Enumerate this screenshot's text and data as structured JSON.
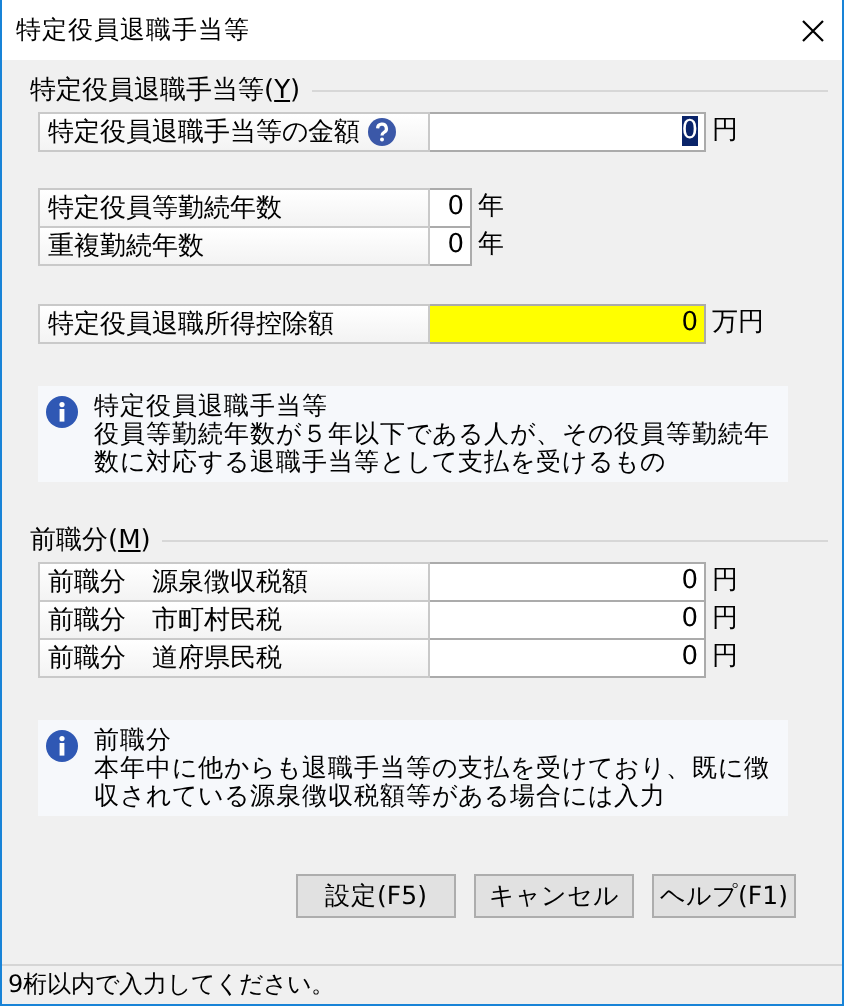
{
  "window": {
    "title": "特定役員退職手当等"
  },
  "retirement": {
    "heading": "特定役員退職手当等(Y)",
    "amount": [
      {
        "label": "特定役員退職手当等の金額",
        "help": true,
        "value": "0",
        "unit": "円",
        "focused": true,
        "highlighted": false
      }
    ],
    "years": [
      {
        "label": "特定役員等勤続年数",
        "help": false,
        "value": "0",
        "unit": "年",
        "focused": false,
        "highlighted": false
      },
      {
        "label": "重複勤続年数",
        "help": false,
        "value": "0",
        "unit": "年",
        "focused": false,
        "highlighted": false
      }
    ],
    "deduction": [
      {
        "label": "特定役員退職所得控除額",
        "help": false,
        "value": "0",
        "unit": "万円",
        "focused": false,
        "highlighted": true
      }
    ],
    "note": {
      "title": "特定役員退職手当等",
      "body": "役員等勤続年数が５年以下である人が、その役員等勤続年数に対応する退職手当等として支払を受けるもの"
    }
  },
  "previous": {
    "heading": "前職分(M)",
    "rows": [
      {
        "label": "前職分　源泉徴収税額",
        "help": false,
        "value": "0",
        "unit": "円",
        "focused": false,
        "highlighted": false
      },
      {
        "label": "前職分　市町村民税",
        "help": false,
        "value": "0",
        "unit": "円",
        "focused": false,
        "highlighted": false
      },
      {
        "label": "前職分　道府県民税",
        "help": false,
        "value": "0",
        "unit": "円",
        "focused": false,
        "highlighted": false
      }
    ],
    "note": {
      "title": "前職分",
      "body": "本年中に他からも退職手当等の支払を受けており、既に徴収されている源泉徴収税額等がある場合には入力"
    }
  },
  "buttons": [
    {
      "label": "設定(F5)"
    },
    {
      "label": "キャンセル"
    },
    {
      "label": "ヘルプ(F1)"
    }
  ],
  "status_bar": "9桁以内で入力してください。"
}
